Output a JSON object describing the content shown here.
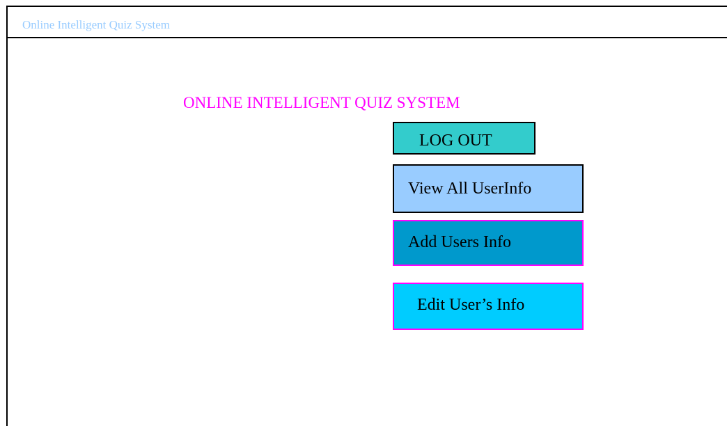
{
  "window": {
    "title": "Online Intelligent Quiz System"
  },
  "main": {
    "heading": "ONLINE INTELLIGENT QUIZ SYSTEM",
    "buttons": {
      "logout": "LOG OUT",
      "view_all": "View All UserInfo",
      "add_users": "Add Users Info",
      "edit_user": "Edit User’s Info"
    }
  },
  "colors": {
    "title_text": "#99ccff",
    "heading_text": "#ff00ff",
    "logout_bg": "#33cccc",
    "view_bg": "#99ccff",
    "add_bg": "#0099cc",
    "edit_bg": "#00ccff",
    "accent_border": "#ff00ff"
  }
}
